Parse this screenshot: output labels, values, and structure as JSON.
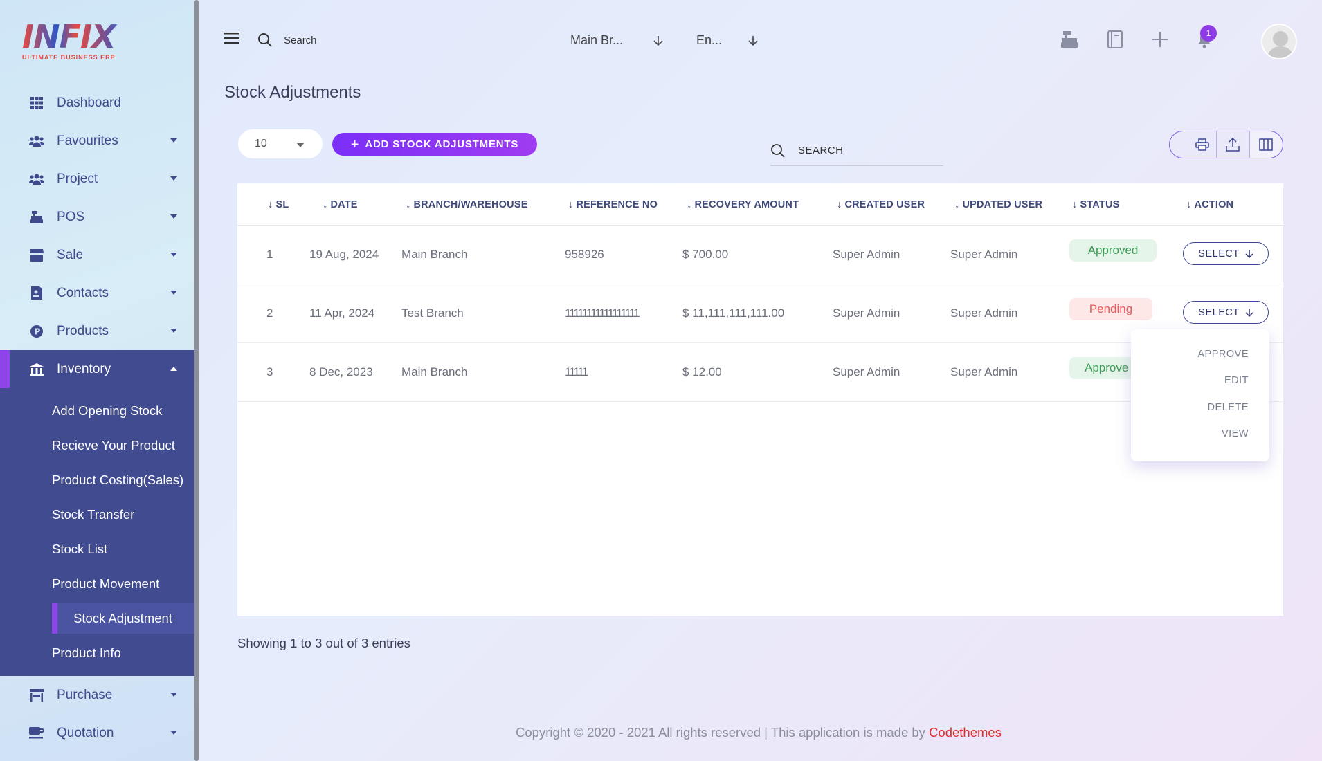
{
  "brand": {
    "logo": "INFIX",
    "tagline": "ULTIMATE BUSINESS ERP"
  },
  "sidebar": {
    "items": [
      {
        "label": "Dashboard",
        "icon": "grid-icon"
      },
      {
        "label": "Favourites",
        "icon": "users-icon"
      },
      {
        "label": "Project",
        "icon": "users-icon"
      },
      {
        "label": "POS",
        "icon": "cash-register-icon"
      },
      {
        "label": "Sale",
        "icon": "store-icon"
      },
      {
        "label": "Contacts",
        "icon": "address-book-icon"
      },
      {
        "label": "Products",
        "icon": "p-circle-icon"
      },
      {
        "label": "Inventory",
        "icon": "warehouse-icon"
      },
      {
        "label": "Purchase",
        "icon": "shop-icon"
      },
      {
        "label": "Quotation",
        "icon": "mug-icon"
      }
    ],
    "inventory_sub": [
      "Add Opening Stock",
      "Recieve Your Product",
      "Product Costing(Sales)",
      "Stock Transfer",
      "Stock List",
      "Product Movement",
      "Stock Adjustment",
      "Product Info"
    ]
  },
  "topbar": {
    "search_label": "Search",
    "branch_select": "Main Br...",
    "language_select": "En...",
    "notification_count": "1"
  },
  "page": {
    "title": "Stock Adjustments",
    "page_length": "10",
    "add_button": "ADD STOCK ADJUSTMENTS",
    "search_label": "SEARCH"
  },
  "table": {
    "headers": [
      "SL",
      "DATE",
      "BRANCH/WAREHOUSE",
      "REFERENCE NO",
      "RECOVERY AMOUNT",
      "CREATED USER",
      "UPDATED USER",
      "STATUS",
      "ACTION"
    ],
    "rows": [
      {
        "sl": "1",
        "date": "19 Aug, 2024",
        "branch": "Main Branch",
        "ref": "958926",
        "amount": "$ 700.00",
        "created": "Super Admin",
        "updated": "Super Admin",
        "status": "Approved",
        "action": "SELECT"
      },
      {
        "sl": "2",
        "date": "11 Apr, 2024",
        "branch": "Test Branch",
        "ref": "11111111111111111",
        "amount": "$ 11,111,111,111.00",
        "created": "Super Admin",
        "updated": "Super Admin",
        "status": "Pending",
        "action": "SELECT"
      },
      {
        "sl": "3",
        "date": "8 Dec, 2023",
        "branch": "Main Branch",
        "ref": "11111",
        "amount": "$ 12.00",
        "created": "Super Admin",
        "updated": "Super Admin",
        "status": "Approve",
        "action": ""
      }
    ]
  },
  "action_menu": [
    "APPROVE",
    "EDIT",
    "DELETE",
    "VIEW"
  ],
  "entries_info": "Showing 1 to 3 out of 3 entries",
  "footer": {
    "text": "Copyright © 2020 - 2021 All rights reserved | This application is made by ",
    "brand": "Codethemes"
  },
  "colors": {
    "accent": "#8e44e8",
    "sidebar_active": "#414b8f",
    "approved": "#3e9b57",
    "pending": "#e85e5e"
  }
}
